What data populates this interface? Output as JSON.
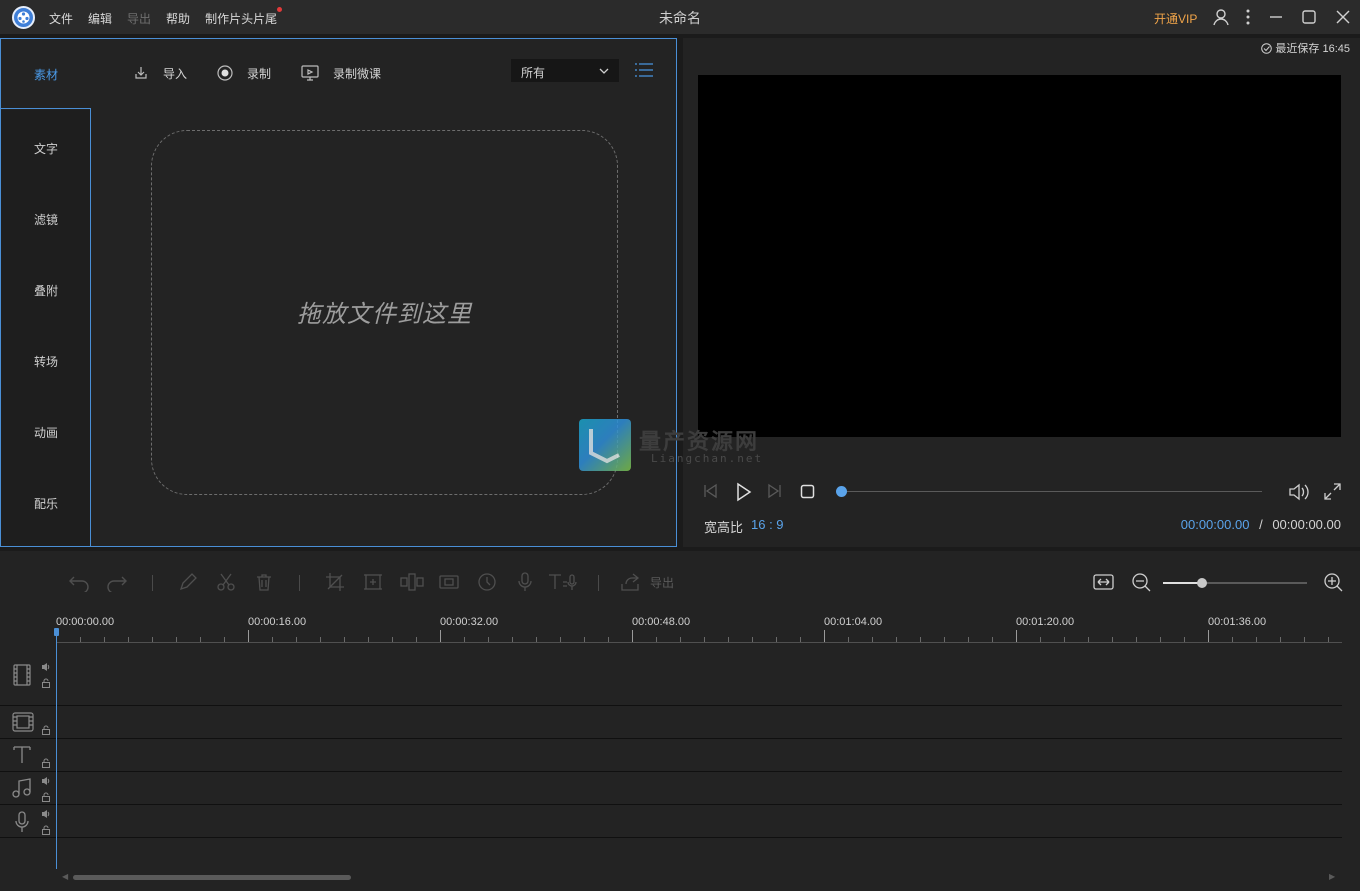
{
  "app": {
    "window_title": "未命名",
    "menu": [
      {
        "label": "文件",
        "enabled": true
      },
      {
        "label": "编辑",
        "enabled": true
      },
      {
        "label": "导出",
        "enabled": false
      },
      {
        "label": "帮助",
        "enabled": true
      },
      {
        "label": "制作片头片尾",
        "enabled": true,
        "badge": "red-dot"
      }
    ],
    "vip_label": "开通VIP",
    "title_icons": [
      "account-icon",
      "more-vertical-icon",
      "minimize-icon",
      "maximize-icon",
      "close-icon"
    ]
  },
  "media_panel": {
    "side_tabs": [
      "素材",
      "文字",
      "滤镜",
      "叠附",
      "转场",
      "动画",
      "配乐"
    ],
    "active_tab": "素材",
    "actions": {
      "import_label": "导入",
      "record_label": "录制",
      "record_lecture_label": "录制微课"
    },
    "filter": {
      "selected": "所有"
    },
    "drop_text": "拖放文件到这里"
  },
  "preview": {
    "save_status": "最近保存 16:45",
    "aspect_label": "宽高比",
    "aspect_value": "16 : 9",
    "time_current": "00:00:00.00",
    "time_separator": "/",
    "time_total": "00:00:00.00",
    "progress": 0
  },
  "timeline": {
    "export_label": "导出",
    "ruler_labels": [
      "00:00:00.00",
      "00:00:16.00",
      "00:00:32.00",
      "00:00:48.00",
      "00:01:04.00",
      "00:01:20.00",
      "00:01:36.00"
    ],
    "tracks": [
      "video-track",
      "pip-track",
      "text-track",
      "music-track",
      "voice-track"
    ],
    "zoom_level": 0.27
  },
  "watermark": {
    "title": "量产资源网",
    "subtitle": "Liangchan.net"
  },
  "colors": {
    "accent": "#4a9ae8",
    "vip": "#f0a449",
    "background": "#232323"
  }
}
